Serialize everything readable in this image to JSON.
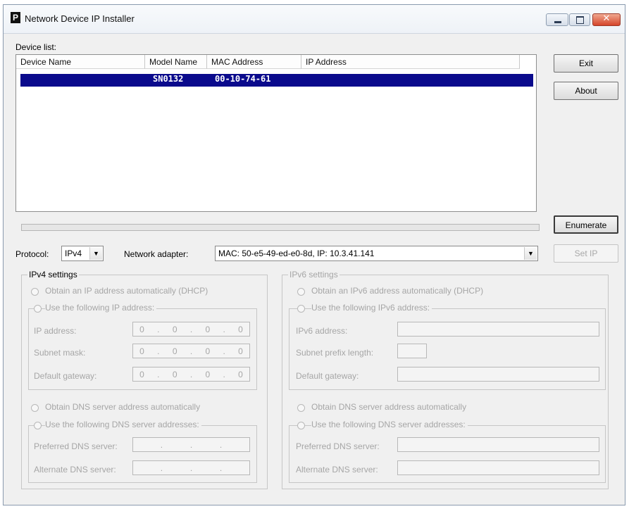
{
  "window": {
    "title": "Network Device IP Installer",
    "logo_letter": "P",
    "close_glyph": "✕"
  },
  "device_list": {
    "label": "Device list:",
    "columns": [
      "Device Name",
      "Model Name",
      "MAC Address",
      "IP Address"
    ],
    "rows": [
      {
        "device_name": "",
        "model_name": "SN0132",
        "mac_address": "00-10-74-61",
        "ip_address": ""
      }
    ]
  },
  "buttons": {
    "exit": "Exit",
    "about": "About",
    "enumerate": "Enumerate",
    "set_ip": "Set IP"
  },
  "protocol": {
    "label": "Protocol:",
    "value": "IPv4",
    "arrow": "▼"
  },
  "network_adapter": {
    "label": "Network adapter:",
    "value": "MAC: 50-e5-49-ed-e0-8d,  IP: 10.3.41.141",
    "arrow": "▼"
  },
  "ipv4": {
    "title": "IPv4 settings",
    "obtain_ip_auto": "Obtain an IP address automatically (DHCP)",
    "use_following_ip": "Use the following IP address:",
    "ip_address_label": "IP address:",
    "subnet_mask_label": "Subnet mask:",
    "gateway_label": "Default gateway:",
    "ip_address": [
      "0",
      "0",
      "0",
      "0"
    ],
    "subnet_mask": [
      "0",
      "0",
      "0",
      "0"
    ],
    "gateway": [
      "0",
      "0",
      "0",
      "0"
    ],
    "obtain_dns_auto": "Obtain DNS server address automatically",
    "use_following_dns": "Use the following DNS server addresses:",
    "preferred_dns_label": "Preferred DNS server:",
    "alternate_dns_label": "Alternate DNS server:"
  },
  "ipv6": {
    "title": "IPv6 settings",
    "obtain_ip_auto": "Obtain an IPv6 address automatically (DHCP)",
    "use_following_ip": "Use the following IPv6 address:",
    "ipv6_address_label": "IPv6 address:",
    "prefix_label": "Subnet prefix length:",
    "gateway_label": "Default gateway:",
    "obtain_dns_auto": "Obtain DNS server address automatically",
    "use_following_dns": "Use the following DNS server addresses:",
    "preferred_dns_label": "Preferred DNS server:",
    "alternate_dns_label": "Alternate DNS server:"
  },
  "colors": {
    "selection": "#0a0a8c",
    "disabled_text": "#a6a6a6",
    "window_bg": "#f0f0f0"
  }
}
